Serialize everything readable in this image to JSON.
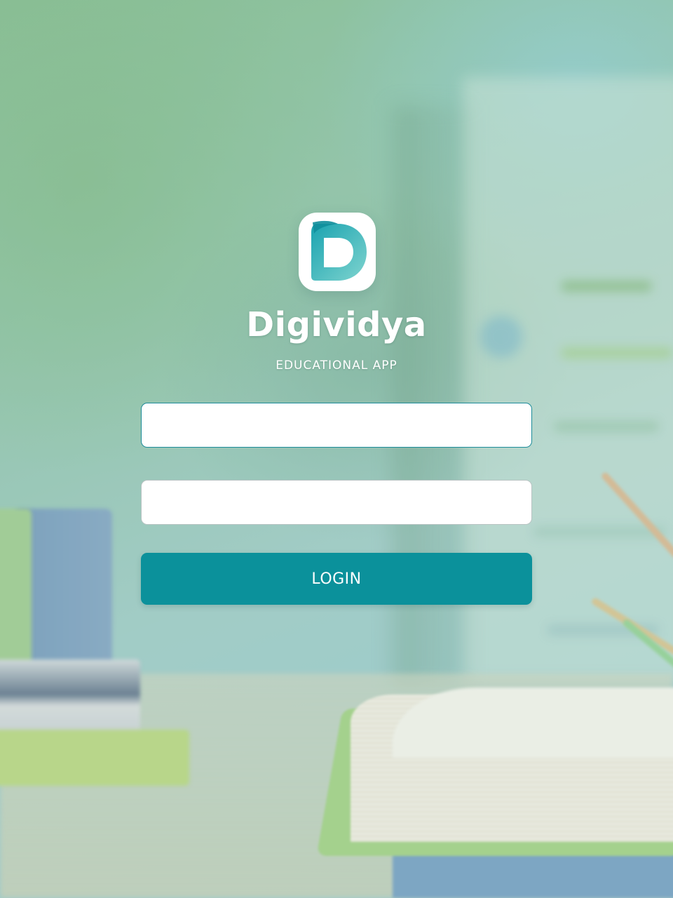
{
  "app": {
    "name": "Digividya",
    "tagline": "EDUCATIONAL APP",
    "logo_icon": "d-letter-logo-icon"
  },
  "login_form": {
    "username": {
      "value": "",
      "placeholder": ""
    },
    "password": {
      "value": "",
      "placeholder": ""
    },
    "submit_label": "LOGIN"
  },
  "colors": {
    "accent": "#0b919b",
    "logo_gradient_start": "#1aa3b0",
    "logo_gradient_end": "#7fd4cf",
    "focus_border": "#1d8c9a",
    "field_background": "#ffffff"
  }
}
